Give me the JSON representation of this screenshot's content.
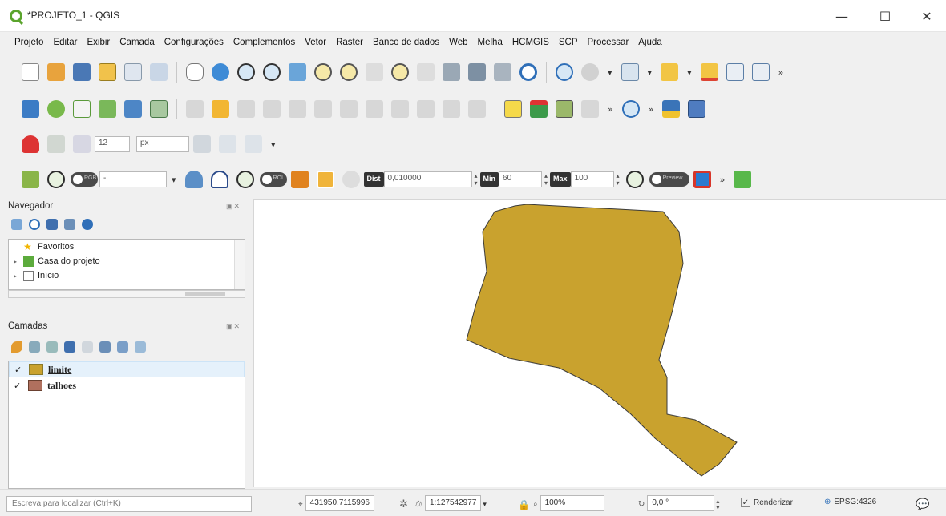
{
  "window": {
    "title": "*PROJETO_1 - QGIS",
    "minimize_glyph": "—",
    "maximize_glyph": "☐",
    "close_glyph": "✕"
  },
  "menu": [
    "Projeto",
    "Editar",
    "Exibir",
    "Camada",
    "Configurações",
    "Complementos",
    "Vetor",
    "Raster",
    "Banco de dados",
    "Web",
    "Melha",
    "HCMGIS",
    "SCP",
    "Processar",
    "Ajuda"
  ],
  "toolbars": {
    "overflow": "»",
    "snap_tolerance": "12",
    "snap_unit": "px",
    "rgb_toggle": "RGB",
    "rgb_select": "-",
    "roi_toggle": "ROI",
    "dist_label": "Dist",
    "dist_value": "0,010000",
    "min_label": "Min",
    "min_value": "60",
    "max_label": "Max",
    "max_value": "100",
    "preview_toggle": "Preview"
  },
  "browser_panel": {
    "title": "Navegador",
    "items": [
      {
        "label": "Favoritos",
        "expandable": false
      },
      {
        "label": "Casa do projeto",
        "expandable": true
      },
      {
        "label": "Início",
        "expandable": true
      }
    ]
  },
  "layers_panel": {
    "title": "Camadas",
    "layers": [
      {
        "name": "limite",
        "checked": true,
        "color": "#c9a22e",
        "selected": true
      },
      {
        "name": "talhoes",
        "checked": true,
        "color": "#b0705e",
        "selected": false
      }
    ]
  },
  "map": {
    "polygon_fill": "#c9a22e",
    "polygon_stroke": "#3a3a3a"
  },
  "status": {
    "locator_placeholder": "Escreva para localizar (Ctrl+K)",
    "coordinate_value": "431950,7115996",
    "scale_value": "1:127542977",
    "magnifier_value": "100%",
    "rotation_value": "0,0 °",
    "render_label": "Renderizar",
    "crs_label": "EPSG:4326"
  }
}
